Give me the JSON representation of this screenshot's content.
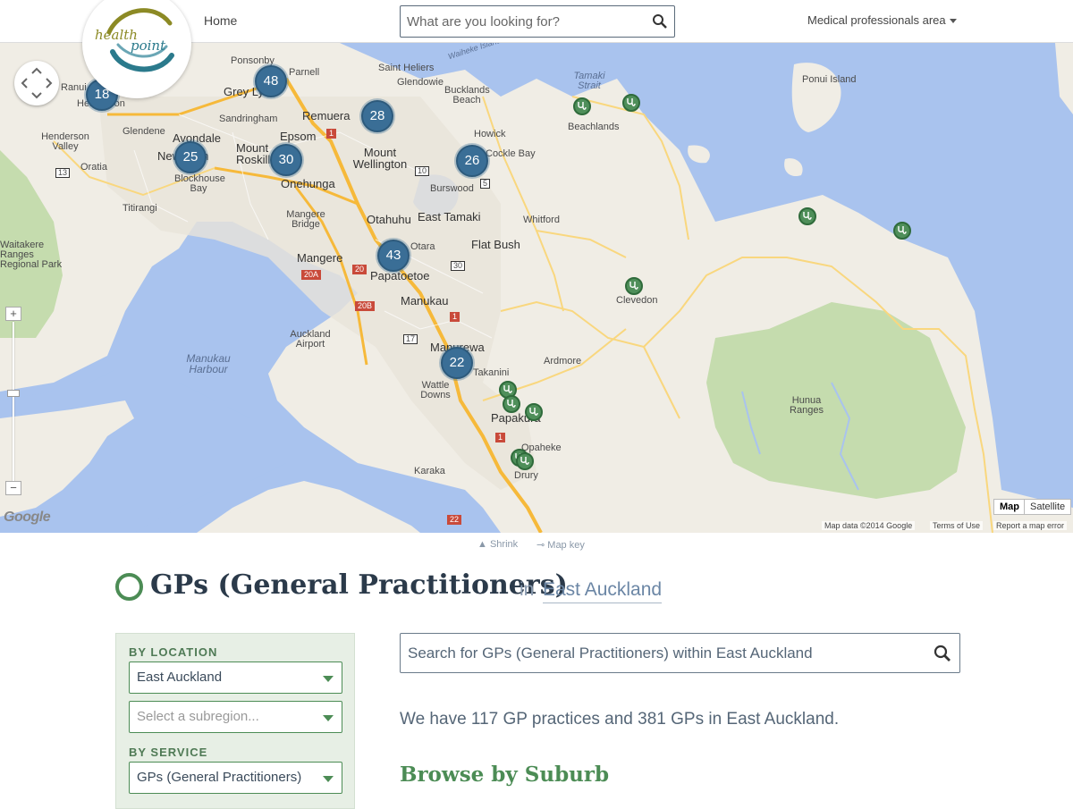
{
  "header": {
    "logo_word1": "health",
    "logo_word2": "point",
    "home_label": "Home",
    "search_placeholder": "What are you looking for?",
    "medical_area_label": "Medical professionals area"
  },
  "map": {
    "clusters": [
      {
        "count": "18"
      },
      {
        "count": "48"
      },
      {
        "count": "28"
      },
      {
        "count": "25"
      },
      {
        "count": "30"
      },
      {
        "count": "26"
      },
      {
        "count": "43"
      },
      {
        "count": "22"
      }
    ],
    "labels": {
      "ponsonby": "Ponsonby",
      "parnell": "Parnell",
      "saint_heliers": "Saint Heliers",
      "glendowie": "Glendowie",
      "bucklands_beach": "Bucklands Beach",
      "waiheke_island": "Waiheke Island",
      "tamaki_strait": "Tamaki Strait",
      "ponui_island": "Ponui Island",
      "beachlands": "Beachlands",
      "grey_lynn": "Grey Lynn",
      "remuera": "Remuera",
      "sandringham": "Sandringham",
      "glendene": "Glendene",
      "henderson_valley": "Henderson Valley",
      "avondale": "Avondale",
      "new_lynn": "New Lynn",
      "mount_roskill": "Mount Roskill",
      "epsom": "Epsom",
      "mount_wellington": "Mount Wellington",
      "howick": "Howick",
      "cockle_bay": "Cockle Bay",
      "burswood": "Burswood",
      "oratia": "Oratia",
      "blockhouse_bay": "Blockhouse Bay",
      "onehunga": "Onehunga",
      "titirangi": "Titirangi",
      "mangere_bridge": "Mangere Bridge",
      "otahuhu": "Otahuhu",
      "east_tamaki": "East Tamaki",
      "whitford": "Whitford",
      "waitakere_ranges": "Waitakere Ranges Regional Park",
      "mangere": "Mangere",
      "otara": "Otara",
      "flat_bush": "Flat Bush",
      "papatoetoe": "Papatoetoe",
      "manukau": "Manukau",
      "clevedon": "Clevedon",
      "auckland_airport": "Auckland Airport",
      "manurewa": "Manurewa",
      "manukau_harbour": "Manukau Harbour",
      "ardmore": "Ardmore",
      "takanini": "Takanini",
      "wattle_downs": "Wattle Downs",
      "hunua_ranges": "Hunua Ranges",
      "papakura": "Papakura",
      "opaheke": "Opaheke",
      "drury": "Drury",
      "karaka": "Karaka",
      "henderson": "Henderson",
      "ranui": "Ranui"
    },
    "road_shields": [
      "1",
      "10",
      "5",
      "13",
      "20",
      "20A",
      "20B",
      "17",
      "30",
      "22",
      "1",
      "1"
    ],
    "map_type_buttons": [
      "Map",
      "Satellite"
    ],
    "active_map_type": "Map",
    "attribution": [
      "Map data ©2014 Google",
      "Terms of Use",
      "Report a map error"
    ],
    "google_mark": "Google"
  },
  "map_tools": {
    "shrink_label": "Shrink",
    "map_key_label": "Map key"
  },
  "page": {
    "title": "GPs (General Practitioners)",
    "in_word": "in",
    "region": "East Auckland"
  },
  "filters": {
    "by_location_label": "BY LOCATION",
    "location_value": "East Auckland",
    "subregion_placeholder": "Select a subregion...",
    "by_service_label": "BY SERVICE",
    "service_value": "GPs (General Practitioners)"
  },
  "main": {
    "search_placeholder": "Search for GPs (General Practitioners) within East Auckland",
    "summary": "We have 117 GP practices and 381 GPs in East Auckland.",
    "browse_title": "Browse by Suburb"
  },
  "colors": {
    "cluster": "#3a6e96",
    "gp_pin": "#4f8f5a",
    "accent_green": "#4c8c55",
    "water": "#a9c3ee",
    "land": "#f0ede5",
    "park": "#c5dcae",
    "road_major": "#f6b93a"
  }
}
